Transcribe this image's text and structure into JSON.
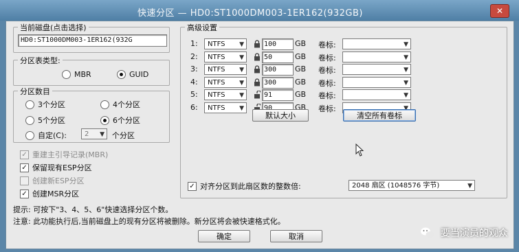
{
  "window": {
    "title": "快速分区 — HD0:ST1000DM003-1ER162(932GB)",
    "close_glyph": "✕"
  },
  "current_disk": {
    "group_title": "当前磁盘(点击选择)",
    "value": "HD0:ST1000DM003-1ER162(932G"
  },
  "partition_table": {
    "group_title": "分区表类型:",
    "options": [
      {
        "label": "MBR",
        "selected": false
      },
      {
        "label": "GUID",
        "selected": true
      }
    ]
  },
  "partition_count": {
    "group_title": "分区数目",
    "options": [
      {
        "label": "3个分区",
        "selected": false
      },
      {
        "label": "4个分区",
        "selected": false
      },
      {
        "label": "5个分区",
        "selected": false
      },
      {
        "label": "6个分区",
        "selected": true
      }
    ],
    "custom_label": "自定(C):",
    "custom_value": "2",
    "custom_suffix": "个分区"
  },
  "options": [
    {
      "label": "重建主引导记录(MBR)",
      "checked": true,
      "disabled": true
    },
    {
      "label": "保留现有ESP分区",
      "checked": true,
      "disabled": false
    },
    {
      "label": "创建新ESP分区",
      "checked": false,
      "disabled": true
    },
    {
      "label": "创建MSR分区",
      "checked": true,
      "disabled": false
    }
  ],
  "advanced": {
    "group_title": "高级设置",
    "unit": "GB",
    "volume_label": "卷标:",
    "rows": [
      {
        "num": "1:",
        "fs": "NTFS",
        "size": "100",
        "locked": true
      },
      {
        "num": "2:",
        "fs": "NTFS",
        "size": "50",
        "locked": true
      },
      {
        "num": "3:",
        "fs": "NTFS",
        "size": "300",
        "locked": true
      },
      {
        "num": "4:",
        "fs": "NTFS",
        "size": "300",
        "locked": true
      },
      {
        "num": "5:",
        "fs": "NTFS",
        "size": "91",
        "locked": false
      },
      {
        "num": "6:",
        "fs": "NTFS",
        "size": "90",
        "locked": false
      }
    ],
    "default_size_button": "默认大小",
    "clear_labels_button": "清空所有卷标",
    "align_checkbox_label": "对齐分区到此扇区数的整数倍:",
    "align_checked": true,
    "align_value": "2048 扇区 (1048576 字节)"
  },
  "hints": {
    "line1": "提示: 可按下\"3、4、5、6\"快速选择分区个数。",
    "line2": "注意: 此功能执行后,当前磁盘上的现有分区将被删除。新分区将会被快速格式化。"
  },
  "buttons": {
    "ok": "确定",
    "cancel": "取消"
  },
  "watermark": {
    "text": "要当演员的观众",
    "icon": "wechat-icon"
  },
  "icons": {
    "dropdown": "▼",
    "check": "✓"
  }
}
